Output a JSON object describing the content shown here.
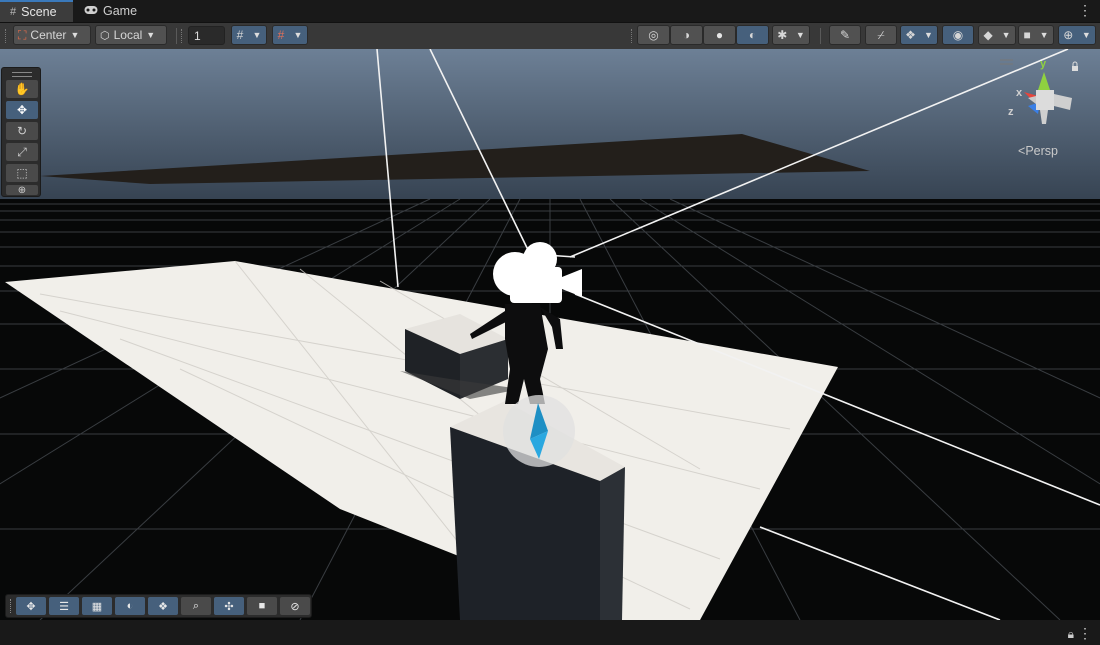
{
  "tabs": [
    {
      "label": "Scene",
      "icon": "grid-icon",
      "active": true
    },
    {
      "label": "Game",
      "icon": "gamepad-icon",
      "active": false
    }
  ],
  "toolbar": {
    "pivot_mode": "Center",
    "pivot_rotation": "Local",
    "grid_snap_value": "1"
  },
  "gizmo": {
    "axes": [
      "y",
      "x",
      "z"
    ],
    "projection_label": "Persp",
    "colors": {
      "x": "#e8453c",
      "y": "#8fd140",
      "z": "#3a7fe6"
    }
  },
  "tools": [
    "hand-tool",
    "move-tool",
    "rotate-tool",
    "scale-tool",
    "rect-tool",
    "transform-tool"
  ],
  "active_tool": "move-tool",
  "overlays": [
    "move-overlay",
    "align-overlay",
    "grid-overlay",
    "lighting-overlay",
    "navmesh-overlay",
    "search-overlay",
    "pivot-overlay",
    "camera-overlay",
    "orientation-overlay"
  ],
  "colors": {
    "accent": "#3a79bb",
    "active_button": "#46607c"
  }
}
